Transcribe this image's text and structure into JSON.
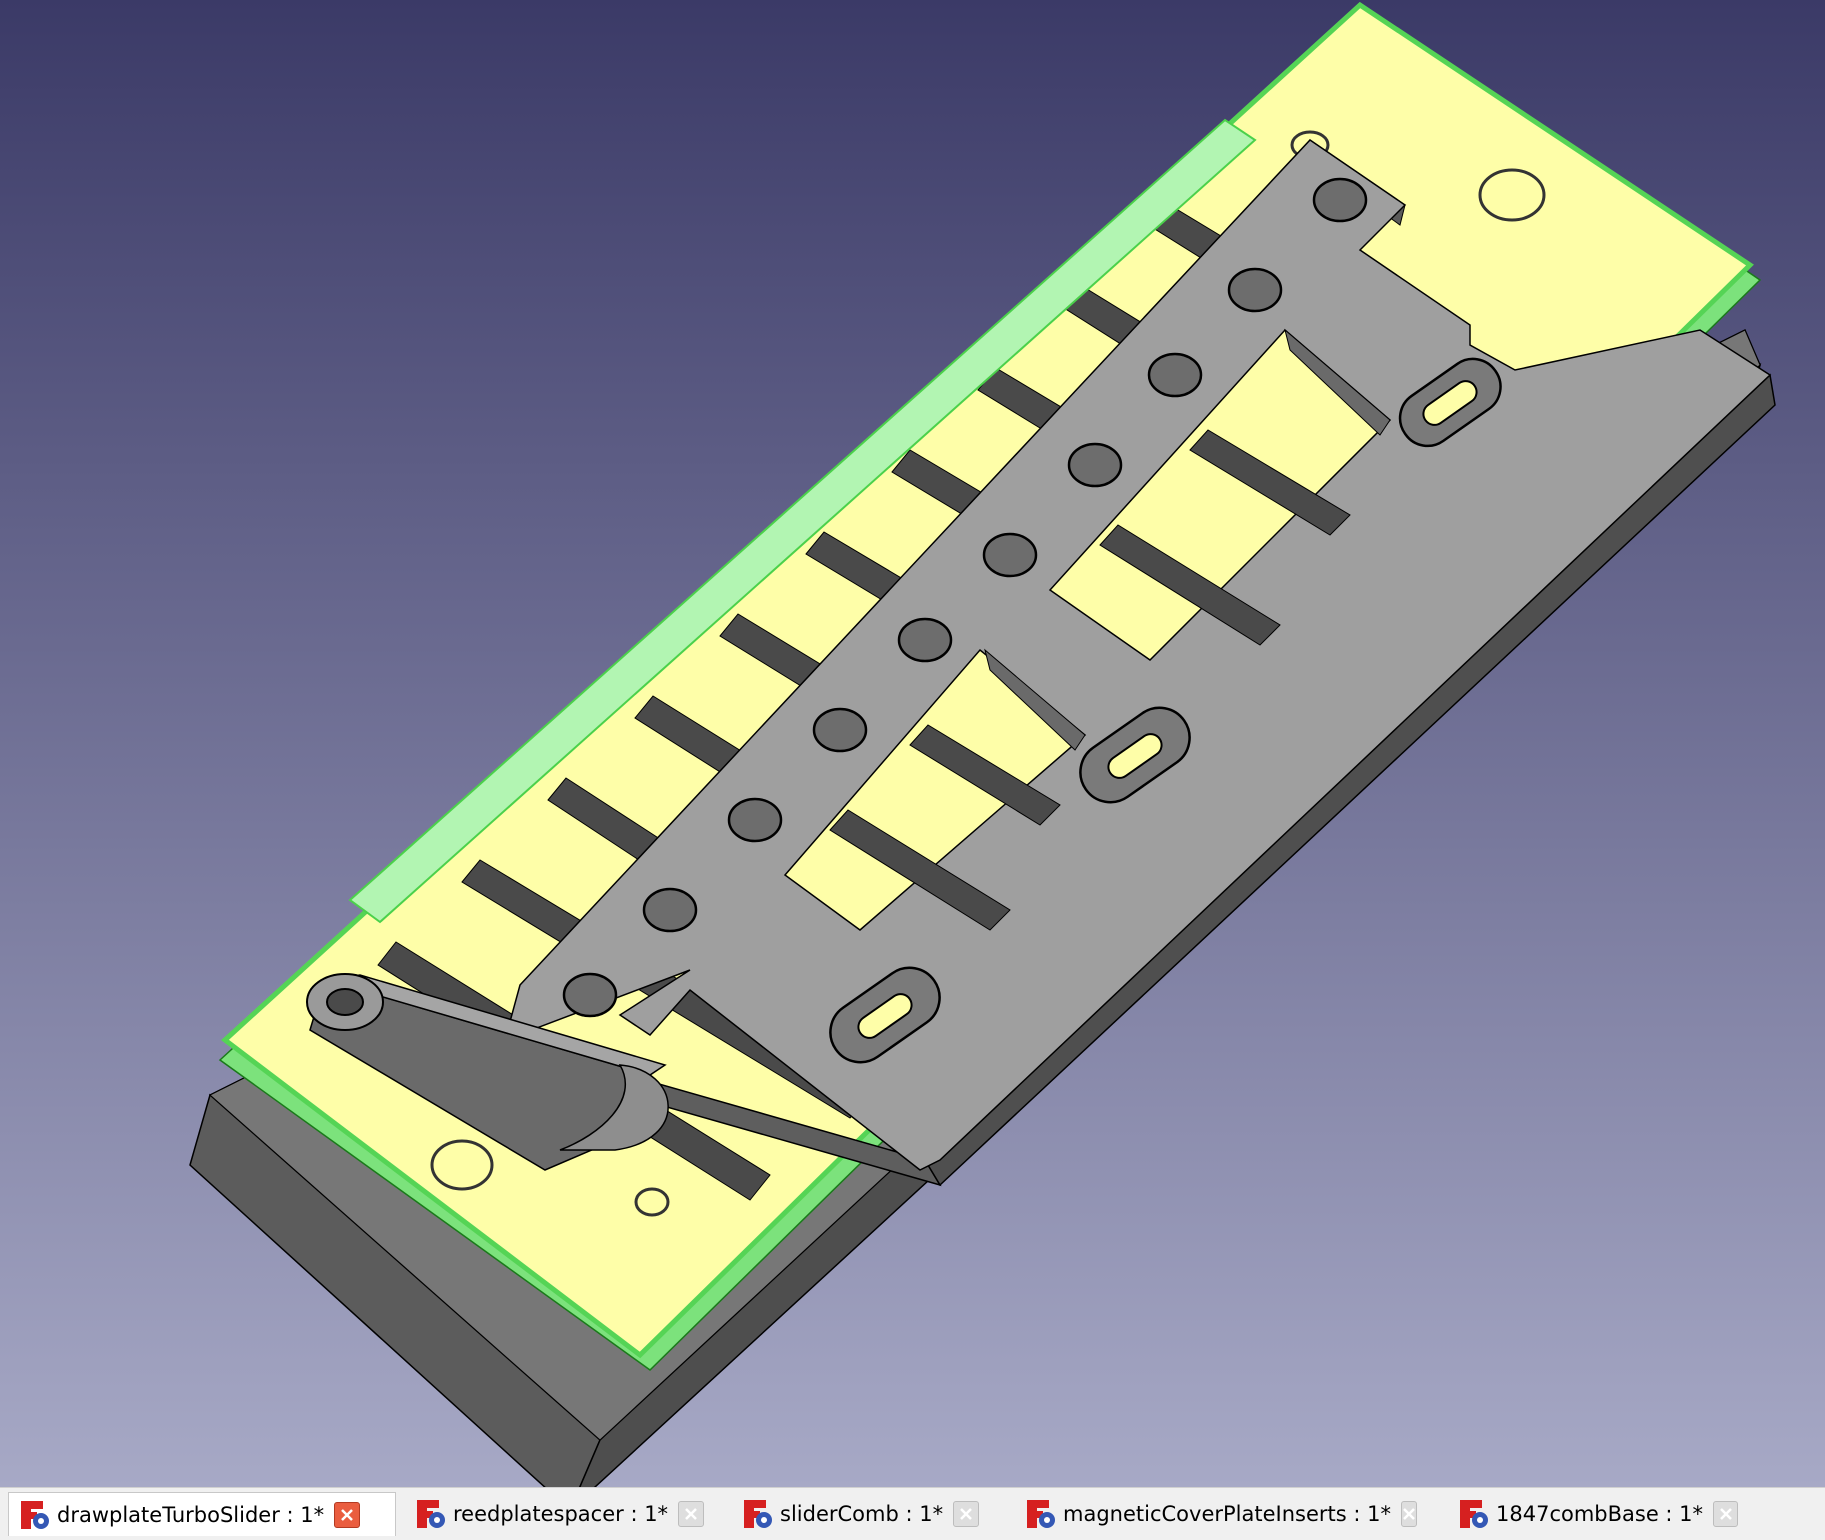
{
  "viewport": {
    "background_top": "#3b3a67",
    "background_bottom": "#a7a9c6",
    "colors": {
      "plate_face": "#fefea8",
      "plate_edge": "#8ff08f",
      "slider_face": "#9e9e9e",
      "slider_side": "#6e6e6e",
      "base_side": "#606060"
    }
  },
  "tabs": [
    {
      "label": "drawplateTurboSlider : 1*",
      "active": true,
      "icon": "freecad-part-icon"
    },
    {
      "label": "reedplatespacer : 1*",
      "active": false,
      "icon": "freecad-part-icon"
    },
    {
      "label": "sliderComb : 1*",
      "active": false,
      "icon": "freecad-part-icon"
    },
    {
      "label": "magneticCoverPlateInserts : 1*",
      "active": false,
      "icon": "freecad-part-icon"
    },
    {
      "label": "1847combBase : 1*",
      "active": false,
      "icon": "freecad-part-icon"
    }
  ]
}
